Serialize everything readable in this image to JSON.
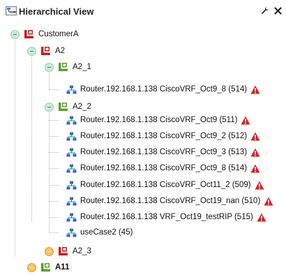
{
  "header": {
    "title": "Hierarchical View",
    "icons": {
      "title": "hierarchy-view-icon",
      "settings": "wrench-icon",
      "close": "close-icon"
    }
  },
  "tree": {
    "root": {
      "label": "CustomerA",
      "state": "expanded"
    },
    "a2": {
      "label": "A2",
      "state": "expanded"
    },
    "a2_1": {
      "label": "A2_1",
      "state": "expanded"
    },
    "a2_1_items": [
      {
        "label": "Router.192.168.1.138 CiscoVRF_Oct9_8 (514)",
        "alert": true
      }
    ],
    "a2_2": {
      "label": "A2_2",
      "state": "expanded"
    },
    "a2_2_items": [
      {
        "label": "Router.192.168.1.138 CiscoVRF_Oct9 (511)",
        "alert": true
      },
      {
        "label": "Router.192.168.1.138 CiscoVRF_Oct9_2 (512)",
        "alert": true
      },
      {
        "label": "Router.192.168.1.138 CiscoVRF_Oct9_3 (513)",
        "alert": true
      },
      {
        "label": "Router.192.168.1.138 CiscoVRF_Oct9_8 (514)",
        "alert": true
      },
      {
        "label": "Router.192.168.1.138 CiscoVRF_Oct11_2 (509)",
        "alert": true
      },
      {
        "label": "Router.192.168.1.138 CiscoVRF_Oct19_nan (510)",
        "alert": true
      },
      {
        "label": "Router.192.168.1.138 VRF_Oct19_testRIP (515)",
        "alert": true
      },
      {
        "label": "useCase2 (45)",
        "alert": false
      }
    ],
    "a2_3": {
      "label": "A2_3",
      "state": "collapsed"
    },
    "a11": {
      "label": "A11",
      "state": "collapsed"
    }
  },
  "colors": {
    "expand_toggle": "#c9ecd9",
    "collapse_toggle": "#f6c56a",
    "group_red": "#c81e1e",
    "group_green": "#5aa02c",
    "router_blue": "#2f6fb5",
    "alert_red": "#d42020"
  }
}
